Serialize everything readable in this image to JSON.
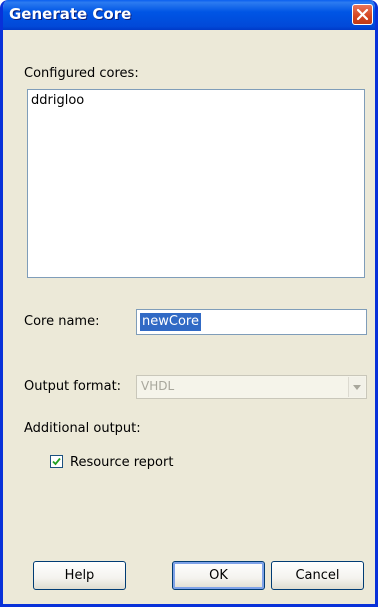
{
  "window": {
    "title": "Generate Core"
  },
  "configured_cores": {
    "label": "Configured cores:",
    "items": [
      "ddrigloo"
    ]
  },
  "core_name": {
    "label": "Core name:",
    "value": "newCore"
  },
  "output_format": {
    "label": "Output format:",
    "selected": "VHDL",
    "enabled": false
  },
  "additional_output": {
    "label": "Additional output:",
    "resource_report": {
      "label": "Resource report",
      "checked": true
    }
  },
  "buttons": {
    "help": "Help",
    "ok": "OK",
    "cancel": "Cancel"
  },
  "colors": {
    "titlebar": "#0055e5",
    "dialog_bg": "#ece9d8",
    "selection": "#316ac5",
    "close_button": "#d44521"
  }
}
